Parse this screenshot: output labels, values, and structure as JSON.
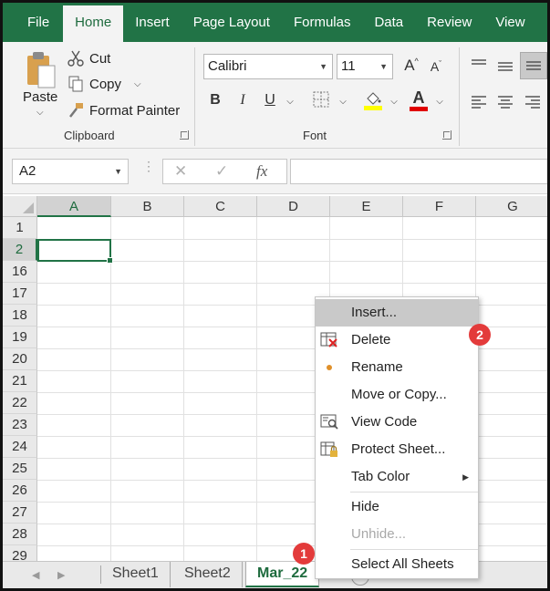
{
  "tabs": [
    "File",
    "Home",
    "Insert",
    "Page Layout",
    "Formulas",
    "Data",
    "Review",
    "View"
  ],
  "active_tab": "Home",
  "clipboard": {
    "paste_label": "Paste",
    "cut_label": "Cut",
    "copy_label": "Copy",
    "format_painter_label": "Format Painter",
    "group_label": "Clipboard"
  },
  "font": {
    "family": "Calibri",
    "size": "11",
    "group_label": "Font",
    "bold_glyph": "B",
    "italic_glyph": "I",
    "underline_glyph": "U",
    "grow_glyph": "A",
    "shrink_glyph": "A",
    "font_color_glyph": "A",
    "fill_color": "#ffff00",
    "font_color": "#e00000"
  },
  "name_box": "A2",
  "formula_icons": {
    "cancel": "✕",
    "enter": "✓",
    "fx": "fx"
  },
  "columns": [
    "A",
    "B",
    "C",
    "D",
    "E",
    "F",
    "G"
  ],
  "rows": [
    "1",
    "2",
    "16",
    "17",
    "18",
    "19",
    "20",
    "21",
    "22",
    "23",
    "24",
    "25",
    "26",
    "27",
    "28",
    "29"
  ],
  "selected_cell": "A2",
  "sheets": [
    "Sheet1",
    "Sheet2",
    "Mar_22"
  ],
  "active_sheet": "Mar_22",
  "add_sheet_glyph": "+",
  "context_menu": {
    "insert": "Insert...",
    "delete": "Delete",
    "rename": "Rename",
    "move_copy": "Move or Copy...",
    "view_code": "View Code",
    "protect_sheet": "Protect Sheet...",
    "tab_color": "Tab Color",
    "hide": "Hide",
    "unhide": "Unhide...",
    "select_all": "Select All Sheets"
  },
  "badges": {
    "one": "1",
    "two": "2"
  },
  "colors": {
    "brand": "#217346",
    "badge": "#e33b3b"
  }
}
